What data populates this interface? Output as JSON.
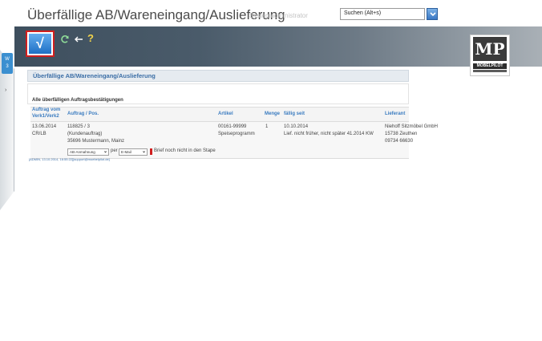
{
  "header": {
    "title": "Überfällige AB/Wareneingang/Auslieferung",
    "subtitle": "Systemadministrator",
    "search_placeholder": "Suchen (Alt+s)"
  },
  "toolbar": {
    "ok_label": "√",
    "refresh_icon": "refresh-icon",
    "back_icon": "back-arrow-icon",
    "help_label": "?"
  },
  "logo": {
    "mark": "MP",
    "text": "MÖBELPILOT"
  },
  "side_tab": {
    "label_line1": "W",
    "label_line2": "3",
    "arrow": "›"
  },
  "panel": {
    "title": "Überfällige AB/Wareneingang/Auslieferung",
    "subtitle": "Alle überfälligen Auftragsbestätigungen"
  },
  "table": {
    "headers": {
      "auftrag_vom_line1": "Auftrag vom",
      "auftrag_vom_line2": "Verk1/Verk2",
      "auftrag_pos": "Auftrag / Pos.",
      "artikel": "Artikel",
      "menge": "Menge",
      "faellig_seit": "fällig seit",
      "lieferant": "Lieferant"
    },
    "rows": [
      {
        "date": "13.06.2014",
        "verk": "CR/LB",
        "auftrag": "118825 / 3",
        "auftrag_type": "(Kundenauftrag)",
        "customer": "35696 Mustermann, Mainz",
        "artikel_nr": "00161-99999",
        "artikel_name": "Speiseprogramm",
        "menge": "1",
        "faellig": "10.10.2014",
        "lief_text": "Lief. nicht früher, nicht später 41.2014 KW",
        "lieferant_name": "Niehoff Sitzmöbel GmbH",
        "lieferant_ort": "15738 Zeuthen",
        "lieferant_tel": "09734 66630",
        "mahnung_select": "AB-Anmahnung",
        "per_label": "per",
        "channel_select": "E-Mail",
        "status_text": "Brief noch nicht in den Stape"
      }
    ]
  },
  "footer": {
    "text": "[ADMIN, 13.10.2014, 16:55:22][support@moebelpilot.de]"
  },
  "colors": {
    "accent": "#3b7cc0",
    "highlight_border": "#d01f1f",
    "toolbar_dark": "#3e4f5e"
  }
}
